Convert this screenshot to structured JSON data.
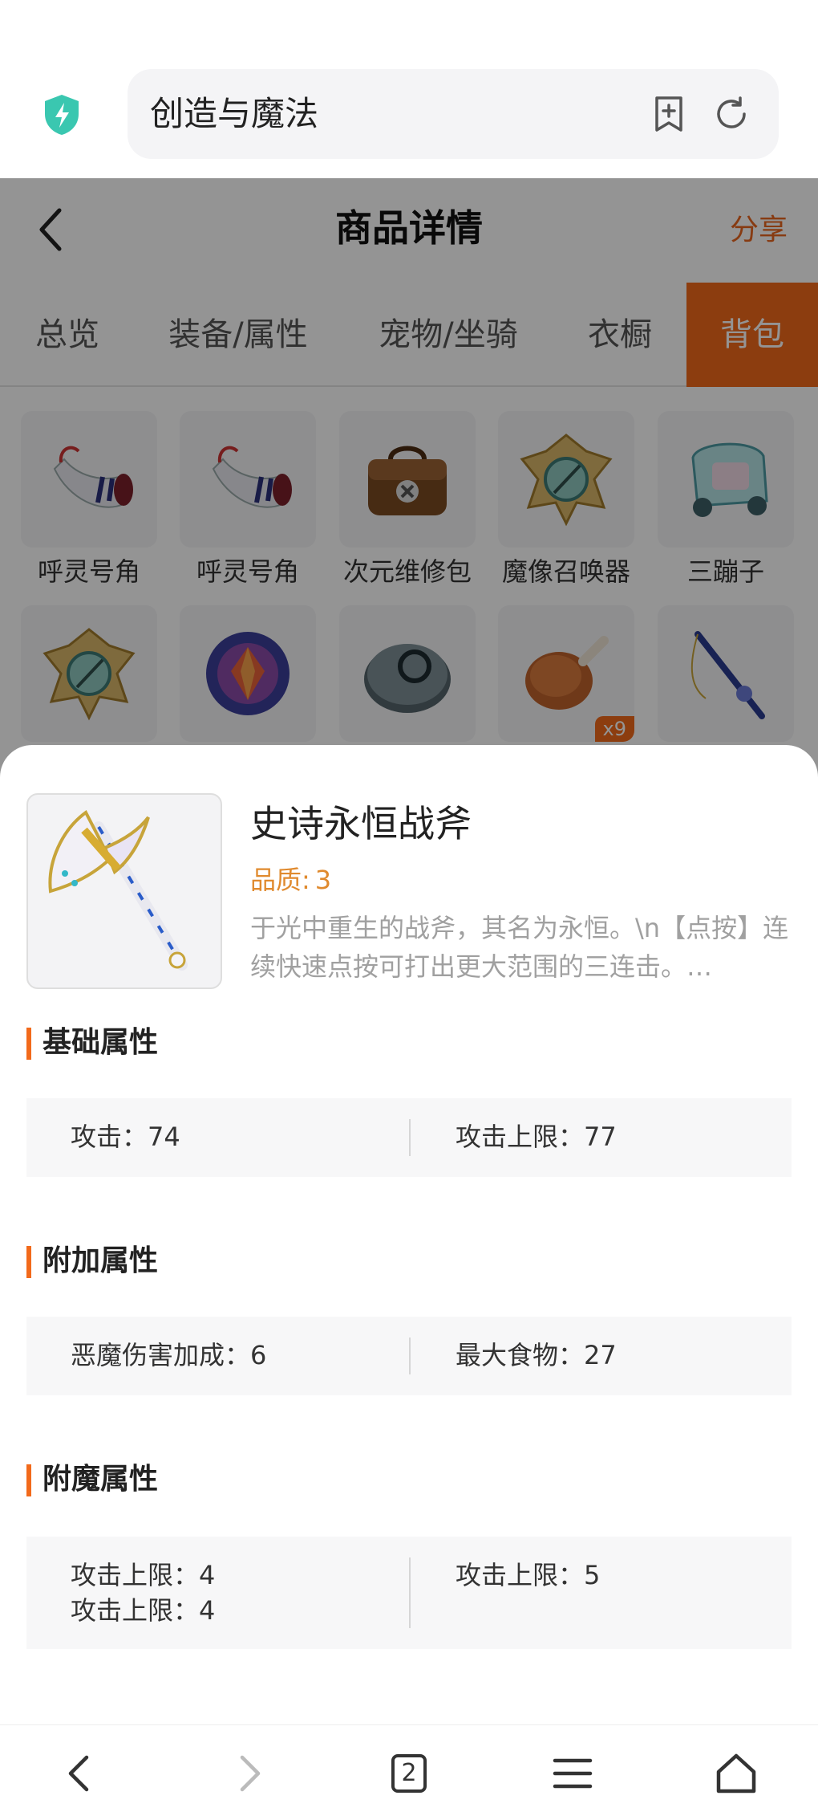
{
  "browser": {
    "url_text": "创造与魔法",
    "icons": [
      "shield-lightning-icon",
      "bookmark-add-icon",
      "refresh-icon"
    ]
  },
  "page": {
    "title": "商品详情",
    "share_label": "分享",
    "tabs": [
      {
        "label": "总览"
      },
      {
        "label": "装备/属性"
      },
      {
        "label": "宠物/坐骑"
      },
      {
        "label": "衣橱"
      },
      {
        "label": "背包",
        "active": true
      }
    ],
    "items_row1": [
      {
        "name": "呼灵号角",
        "icon": "horn-icon"
      },
      {
        "name": "呼灵号角",
        "icon": "horn-icon"
      },
      {
        "name": "次元维修包",
        "icon": "repair-bag-icon"
      },
      {
        "name": "魔像召唤器",
        "icon": "golem-summoner-icon"
      },
      {
        "name": "三蹦子",
        "icon": "tricycle-icon"
      }
    ],
    "items_row2": [
      {
        "icon": "compass-emblem-icon"
      },
      {
        "icon": "crystal-emblem-icon"
      },
      {
        "icon": "stone-disc-icon"
      },
      {
        "icon": "drumstick-icon",
        "count": "x9"
      },
      {
        "icon": "fishing-rod-icon"
      }
    ]
  },
  "sheet": {
    "item_name": "史诗永恒战斧",
    "quality_label": "品质:",
    "quality_value": "3",
    "description": "于光中重生的战斧，其名为永恒。\\n【点按】连续快速点按可打出更大范围的三连击。…",
    "sections": {
      "base": {
        "title": "基础属性",
        "left": [
          "攻击：74"
        ],
        "right": [
          "攻击上限：77"
        ]
      },
      "extra": {
        "title": "附加属性",
        "left": [
          "恶魔伤害加成：6"
        ],
        "right": [
          "最大食物：27"
        ]
      },
      "enchant": {
        "title": "附魔属性",
        "left": [
          "攻击上限：4",
          "攻击上限：4"
        ],
        "right": [
          "攻击上限：5"
        ]
      }
    }
  },
  "bottom_nav": {
    "tab_count": "2",
    "icons": [
      "back-icon",
      "forward-icon",
      "tabs-icon",
      "menu-icon",
      "home-icon"
    ]
  },
  "colors": {
    "accent": "#f26a1b",
    "quality": "#e08a2e",
    "browser_shield": "#3ac7b0"
  }
}
